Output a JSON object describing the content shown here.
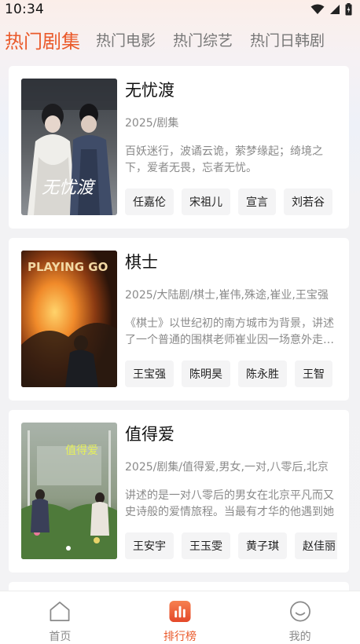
{
  "status_bar": {
    "time": "10:34"
  },
  "tabs": [
    {
      "label": "热门剧集",
      "active": true
    },
    {
      "label": "热门电影",
      "active": false
    },
    {
      "label": "热门综艺",
      "active": false
    },
    {
      "label": "热门日韩剧",
      "active": false
    }
  ],
  "items": [
    {
      "title": "无忧渡",
      "meta": "2025/剧集",
      "desc": "百妖迷行，波谲云诡，萦梦缘起；绮境之下，爱者无畏，忘者无忧。",
      "actors": [
        "任嘉伦",
        "宋祖儿",
        "宣言",
        "刘若谷"
      ],
      "poster_text": "无忧渡"
    },
    {
      "title": "棋士",
      "meta": "2025/大陆剧/棋士,崔伟,殊途,崔业,王宝强",
      "desc": "《棋士》以世纪初的南方城市为背景，讲述了一个普通的围棋老师崔业因一场意外走上犯罪道路的故事。",
      "actors": [
        "王宝强",
        "陈明昊",
        "陈永胜",
        "王智"
      ],
      "poster_text": "PLAYING GO"
    },
    {
      "title": "值得爱",
      "meta": "2025/剧集/值得爱,男女,一对,八零后,北京",
      "desc": "讲述的是一对八零后的男女在北京平凡而又史诗般的爱情旅程。当最有才华的他遇到她",
      "actors": [
        "王安宇",
        "王玉雯",
        "黄子琪",
        "赵佳丽"
      ],
      "poster_text": "值得爱"
    }
  ],
  "bottom_nav": [
    {
      "label": "首页",
      "icon": "home-icon",
      "active": false
    },
    {
      "label": "排行榜",
      "icon": "ranking-icon",
      "active": true
    },
    {
      "label": "我的",
      "icon": "profile-icon",
      "active": false
    }
  ],
  "colors": {
    "accent": "#ea5a2b",
    "text_muted": "#8a8a8a"
  }
}
